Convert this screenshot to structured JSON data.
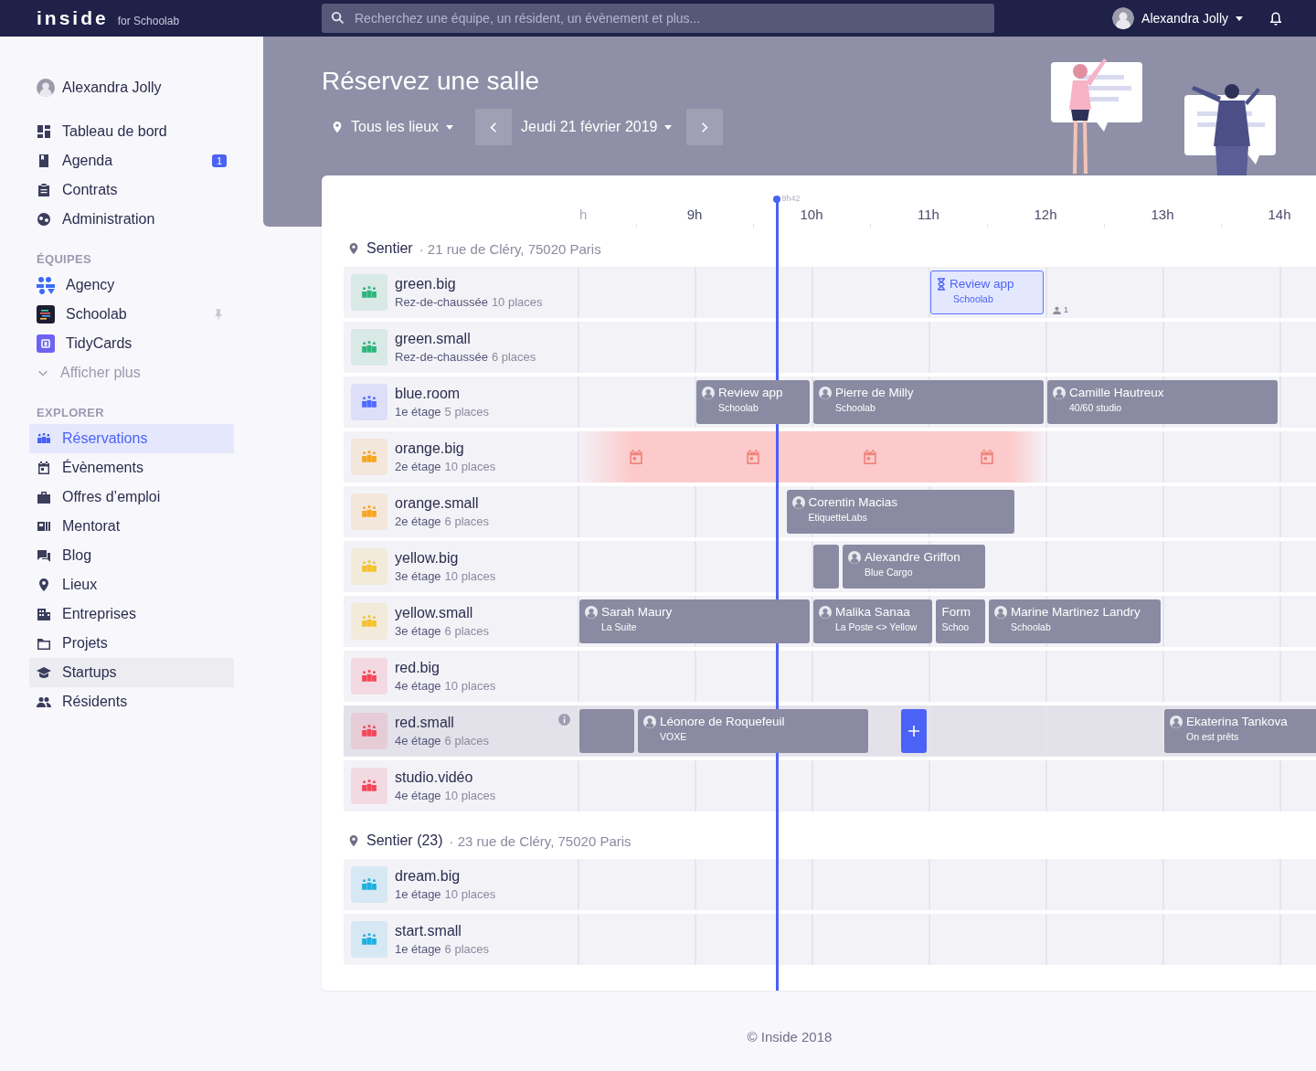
{
  "topbar": {
    "logo": "inside",
    "logo_suffix": "for Schoolab",
    "search_placeholder": "Recherchez une équipe, un résident, un évènement et plus...",
    "user": "Alexandra Jolly"
  },
  "sidebar": {
    "user": "Alexandra Jolly",
    "nav": [
      {
        "label": "Tableau de bord"
      },
      {
        "label": "Agenda",
        "badge": "1"
      },
      {
        "label": "Contrats"
      },
      {
        "label": "Administration"
      }
    ],
    "teams_heading": "ÉQUIPES",
    "teams": [
      {
        "label": "Agency",
        "pinned": false
      },
      {
        "label": "Schoolab",
        "pinned": true
      },
      {
        "label": "TidyCards",
        "pinned": false
      }
    ],
    "show_more": "Afficher plus",
    "explore_heading": "EXPLORER",
    "explore": [
      {
        "label": "Réservations",
        "selected": true,
        "hovered": false
      },
      {
        "label": "Évènements",
        "selected": false,
        "hovered": false
      },
      {
        "label": "Offres d’emploi",
        "selected": false,
        "hovered": false
      },
      {
        "label": "Mentorat",
        "selected": false,
        "hovered": false
      },
      {
        "label": "Blog",
        "selected": false,
        "hovered": false
      },
      {
        "label": "Lieux",
        "selected": false,
        "hovered": false
      },
      {
        "label": "Entreprises",
        "selected": false,
        "hovered": false
      },
      {
        "label": "Projets",
        "selected": false,
        "hovered": false
      },
      {
        "label": "Startups",
        "selected": false,
        "hovered": true
      },
      {
        "label": "Résidents",
        "selected": false,
        "hovered": false
      }
    ]
  },
  "hero": {
    "title": "Réservez une salle",
    "location": "Tous les lieux",
    "date": "Jeudi 21 février 2019"
  },
  "timeline": {
    "hours": [
      "h",
      "9h",
      "10h",
      "11h",
      "12h",
      "13h",
      "14h"
    ],
    "now": "9h42",
    "sites": [
      {
        "name": "Sentier",
        "address": "· 21 rue de Cléry, 75020 Paris",
        "rooms": [
          {
            "name": "green.big",
            "floor": "Rez-de-chaussée",
            "capacity": "10 places",
            "color": "#2fb57a",
            "highlighted": false,
            "info": false,
            "bookings": [
              {
                "kind": "pending",
                "title": "Review app",
                "subtitle": "Schoolab",
                "attendees": "1"
              }
            ]
          },
          {
            "name": "green.small",
            "floor": "Rez-de-chaussée",
            "capacity": "6 places",
            "color": "#2fb57a",
            "highlighted": false,
            "info": false
          },
          {
            "name": "blue.room",
            "floor": "1e étage",
            "capacity": "5 places",
            "color": "#4f6bff",
            "highlighted": false,
            "info": false,
            "bookings": [
              {
                "kind": "booking",
                "title": "Review app",
                "subtitle": "Schoolab",
                "avatar": true
              },
              {
                "kind": "booking",
                "title": "Pierre de Milly",
                "subtitle": "Schoolab",
                "avatar": true
              },
              {
                "kind": "booking",
                "title": "Camille Hautreux",
                "subtitle": "40/60 studio",
                "avatar": true
              }
            ]
          },
          {
            "name": "orange.big",
            "floor": "2e étage",
            "capacity": "10 places",
            "color": "#f5a623",
            "highlighted": false,
            "info": false,
            "bookings": [
              {
                "kind": "blocked"
              }
            ]
          },
          {
            "name": "orange.small",
            "floor": "2e étage",
            "capacity": "6 places",
            "color": "#f5a623",
            "highlighted": false,
            "info": false,
            "bookings": [
              {
                "kind": "booking",
                "title": "Corentin Macias",
                "subtitle": "EtiquetteLabs",
                "avatar": true
              }
            ]
          },
          {
            "name": "yellow.big",
            "floor": "3e étage",
            "capacity": "10 places",
            "color": "#f2c230",
            "highlighted": false,
            "info": false,
            "bookings": [
              {
                "kind": "blank"
              },
              {
                "kind": "booking",
                "title": "Alexandre Griffon",
                "subtitle": "Blue Cargo",
                "avatar": true
              }
            ]
          },
          {
            "name": "yellow.small",
            "floor": "3e étage",
            "capacity": "6 places",
            "color": "#f2c230",
            "highlighted": false,
            "info": false,
            "bookings": [
              {
                "kind": "booking",
                "title": "Sarah Maury",
                "subtitle": "La Suite",
                "avatar": true
              },
              {
                "kind": "booking",
                "title": "Malika Sanaa",
                "subtitle": "La Poste <> Yellow",
                "avatar": true
              },
              {
                "kind": "booking",
                "title": "Form",
                "subtitle": "Schoo",
                "avatar": false
              },
              {
                "kind": "booking",
                "title": "Marine Martinez Landry",
                "subtitle": "Schoolab",
                "avatar": true
              }
            ]
          },
          {
            "name": "red.big",
            "floor": "4e étage",
            "capacity": "10 places",
            "color": "#f5475b",
            "highlighted": false,
            "info": false
          },
          {
            "name": "red.small",
            "floor": "4e étage",
            "capacity": "6 places",
            "color": "#f5475b",
            "highlighted": true,
            "info": true,
            "bookings": [
              {
                "kind": "blank"
              },
              {
                "kind": "booking",
                "title": "Léonore de Roquefeuil",
                "subtitle": "VOXE",
                "avatar": true
              },
              {
                "kind": "add"
              },
              {
                "kind": "booking",
                "title": "Ekaterina Tankova",
                "subtitle": "On est prêts",
                "avatar": true
              }
            ]
          },
          {
            "name": "studio.vidéo",
            "floor": "4e étage",
            "capacity": "10 places",
            "color": "#f5475b",
            "highlighted": false,
            "info": false
          }
        ]
      },
      {
        "name": "Sentier (23)",
        "address": "· 23 rue de Cléry, 75020 Paris",
        "rooms": [
          {
            "name": "dream.big",
            "floor": "1e étage",
            "capacity": "10 places",
            "color": "#1fb0dd",
            "highlighted": false,
            "info": false
          },
          {
            "name": "start.small",
            "floor": "1e étage",
            "capacity": "6 places",
            "color": "#1fb0dd",
            "highlighted": false,
            "info": false
          }
        ]
      }
    ]
  },
  "footer": "© Inside 2018"
}
